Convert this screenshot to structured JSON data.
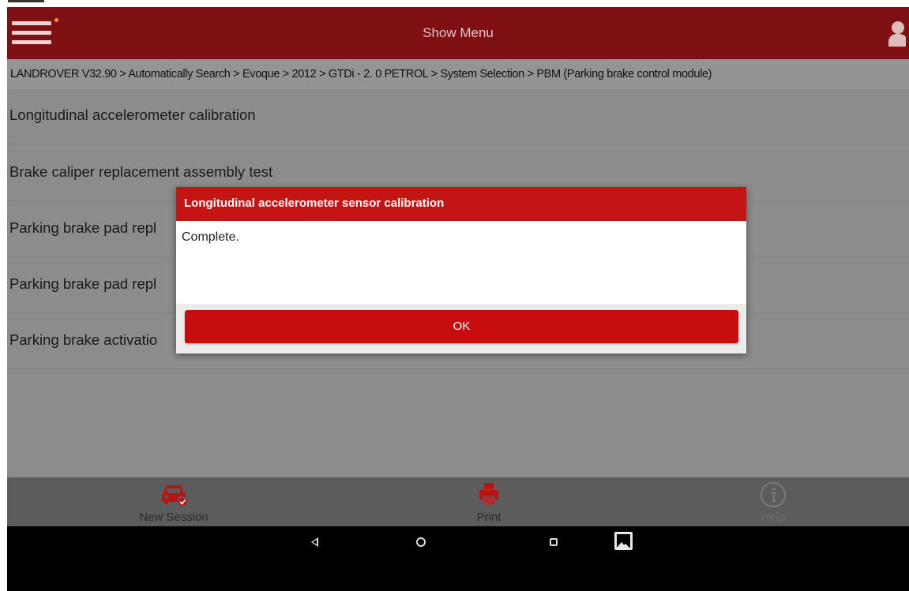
{
  "header": {
    "title": "Show Menu"
  },
  "breadcrumb": "LANDROVER V32.90 > Automatically Search > Evoque > 2012 > GTDi - 2. 0 PETROL > System Selection > PBM (Parking brake control module)",
  "functions": [
    {
      "label": "Longitudinal accelerometer calibration"
    },
    {
      "label": "Brake caliper replacement assembly test"
    },
    {
      "label": "Parking brake pad repl"
    },
    {
      "label": "Parking brake pad repl"
    },
    {
      "label": "Parking brake activatio"
    }
  ],
  "dialog": {
    "title": "Longitudinal accelerometer sensor calibration",
    "message": "Complete.",
    "ok_label": "OK"
  },
  "toolbar": {
    "new_session": {
      "label": "New Session",
      "icon": "car-check-icon"
    },
    "print": {
      "label": "Print",
      "icon": "printer-icon"
    },
    "help": {
      "label": "Help",
      "icon": "info-icon"
    }
  },
  "navbar": {
    "icons": [
      "back-icon",
      "home-icon",
      "recent-apps-icon",
      "gallery-icon"
    ]
  },
  "colors": {
    "appbar": "#7e0f13",
    "dialog_header": "#c41414",
    "ok_button": "#c80d0d",
    "accent_red": "#b81414"
  }
}
